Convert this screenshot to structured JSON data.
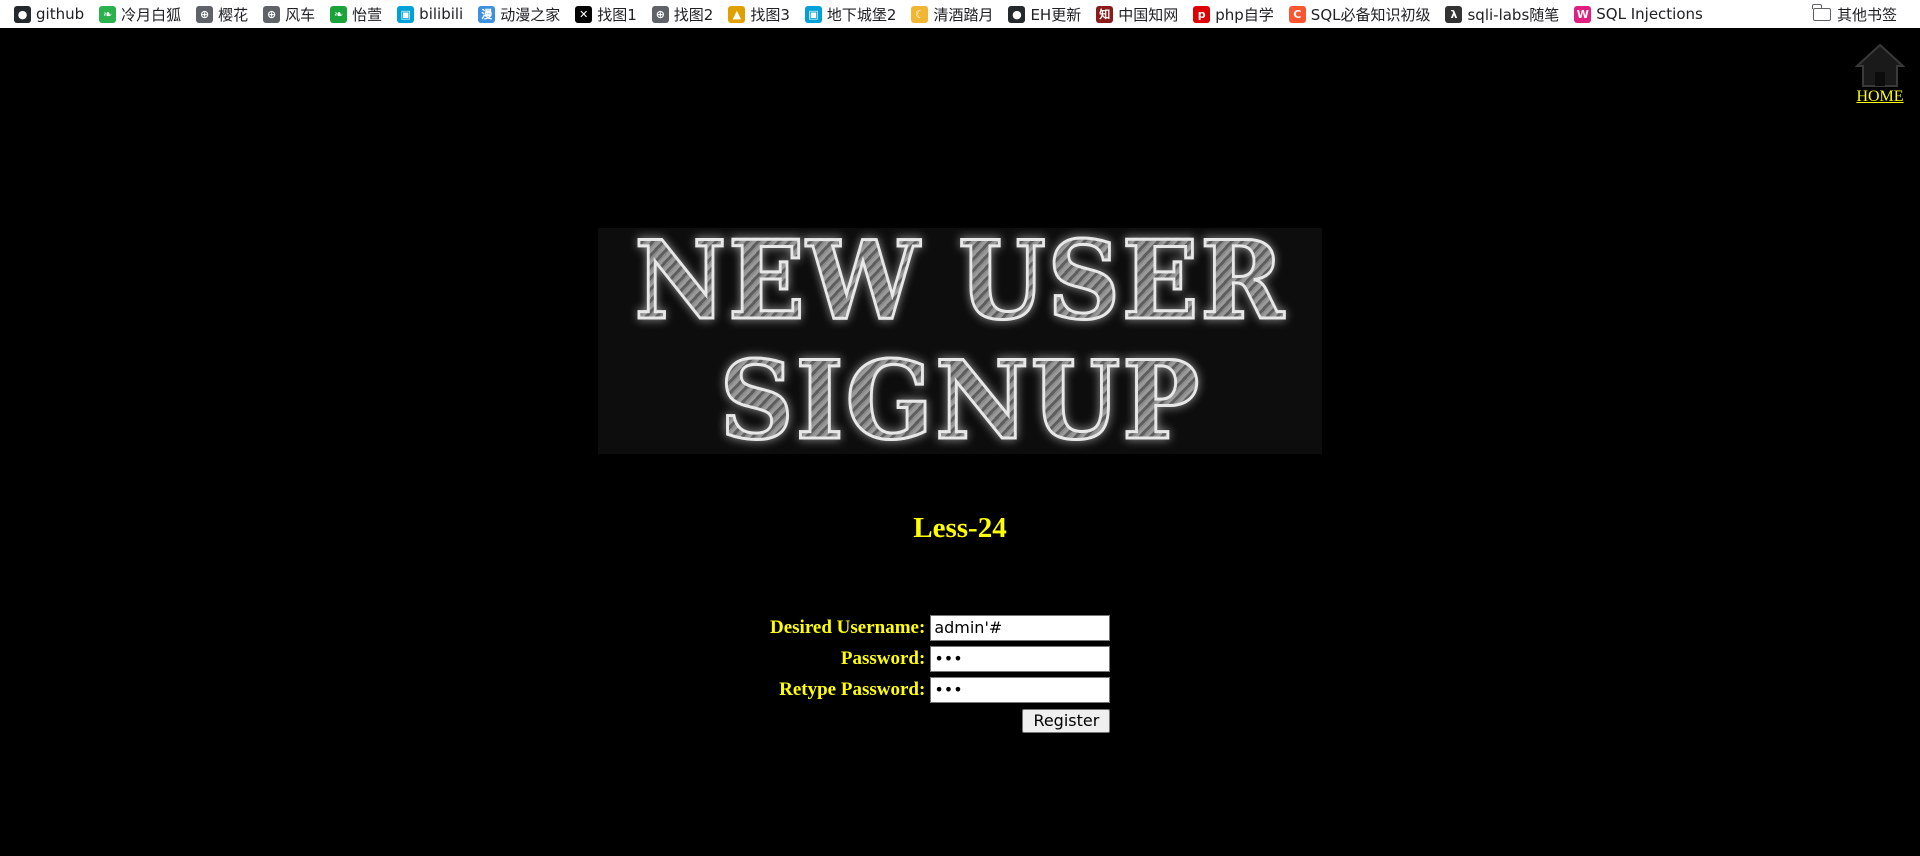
{
  "bookmarks": {
    "items": [
      {
        "label": "github",
        "icon": "github-icon",
        "color": "#24292e",
        "glyph": "●"
      },
      {
        "label": "冷月白狐",
        "icon": "leaf-icon",
        "color": "#2bb24c",
        "glyph": "❧"
      },
      {
        "label": "樱花",
        "icon": "globe-icon",
        "color": "#5f6368",
        "glyph": "⊕"
      },
      {
        "label": "风车",
        "icon": "globe-icon",
        "color": "#5f6368",
        "glyph": "⊕"
      },
      {
        "label": "怡萱",
        "icon": "leaf-icon",
        "color": "#1aa33a",
        "glyph": "❧"
      },
      {
        "label": "bilibili",
        "icon": "bilibili-icon",
        "color": "#00a1d6",
        "glyph": "▣"
      },
      {
        "label": "动漫之家",
        "icon": "manga-icon",
        "color": "#3d8fe0",
        "glyph": "漫"
      },
      {
        "label": "找图1",
        "icon": "x-icon",
        "color": "#000000",
        "glyph": "✕"
      },
      {
        "label": "找图2",
        "icon": "globe-icon",
        "color": "#5f6368",
        "glyph": "⊕"
      },
      {
        "label": "找图3",
        "icon": "image-icon",
        "color": "#e0a100",
        "glyph": "▲"
      },
      {
        "label": "地下城堡2",
        "icon": "bilibili-icon",
        "color": "#00a1d6",
        "glyph": "▣"
      },
      {
        "label": "清酒踏月",
        "icon": "moon-icon",
        "color": "#f2b632",
        "glyph": "☾"
      },
      {
        "label": "EH更新",
        "icon": "github-icon",
        "color": "#24292e",
        "glyph": "●"
      },
      {
        "label": "中国知网",
        "icon": "cnki-icon",
        "color": "#8b1a1a",
        "glyph": "知"
      },
      {
        "label": "php自学",
        "icon": "php-icon",
        "color": "#e00000",
        "glyph": "p"
      },
      {
        "label": "SQL必备知识初级",
        "icon": "c-icon",
        "color": "#fc5531",
        "glyph": "C"
      },
      {
        "label": "sqli-labs随笔",
        "icon": "lambda-icon",
        "color": "#333333",
        "glyph": "λ"
      },
      {
        "label": "SQL Injections",
        "icon": "w-icon",
        "color": "#e02080",
        "glyph": "W"
      }
    ],
    "other_label": "其他书签"
  },
  "home": {
    "label": "HOME"
  },
  "banner": {
    "line1": "NEW USER",
    "line2": "SIGNUP"
  },
  "lesson": {
    "title": "Less-24"
  },
  "form": {
    "username_label": "Desired Username:",
    "username_value": "admin'#",
    "password_label": "Password:",
    "password_value": "123",
    "retype_label": "Retype Password:",
    "retype_value": "123",
    "register_label": "Register"
  }
}
